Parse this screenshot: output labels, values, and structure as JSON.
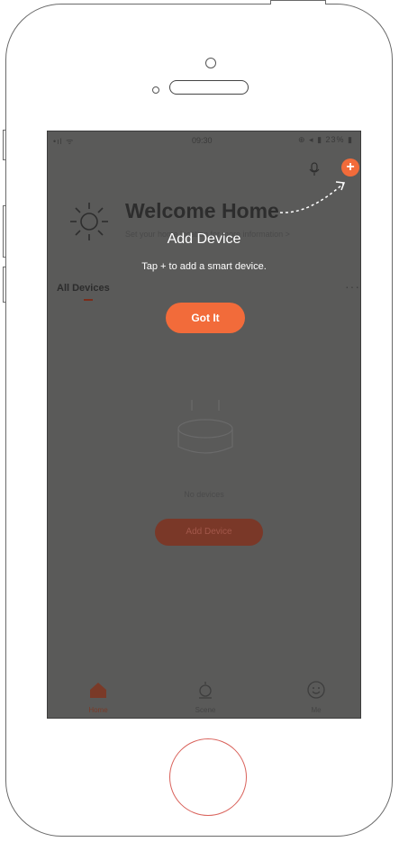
{
  "status_bar": {
    "time": "09:30",
    "signal": "•ıl ᯤ",
    "indicators": "⊕ ◂ ▮ 23% ▮"
  },
  "header": {
    "welcome": "Welcome Home",
    "subtitle": "Set your home location for more information >"
  },
  "tabs": {
    "all_devices": "All Devices",
    "more": "···"
  },
  "coach": {
    "title": "Add Device",
    "description": "Tap + to add a smart device.",
    "button": "Got It"
  },
  "empty_state": {
    "text": "No devices",
    "button": "Add Device"
  },
  "tabbar": [
    {
      "label": "Home",
      "icon": "home-icon"
    },
    {
      "label": "Scene",
      "icon": "scene-icon"
    },
    {
      "label": "Me",
      "icon": "me-icon"
    }
  ],
  "icons": {
    "plus": "+",
    "mic": "mic-icon",
    "weather": "sun-icon"
  },
  "colors": {
    "accent": "#f26b3a",
    "overlay": "#5a5a59",
    "add_button_dim": "#7a3828"
  }
}
